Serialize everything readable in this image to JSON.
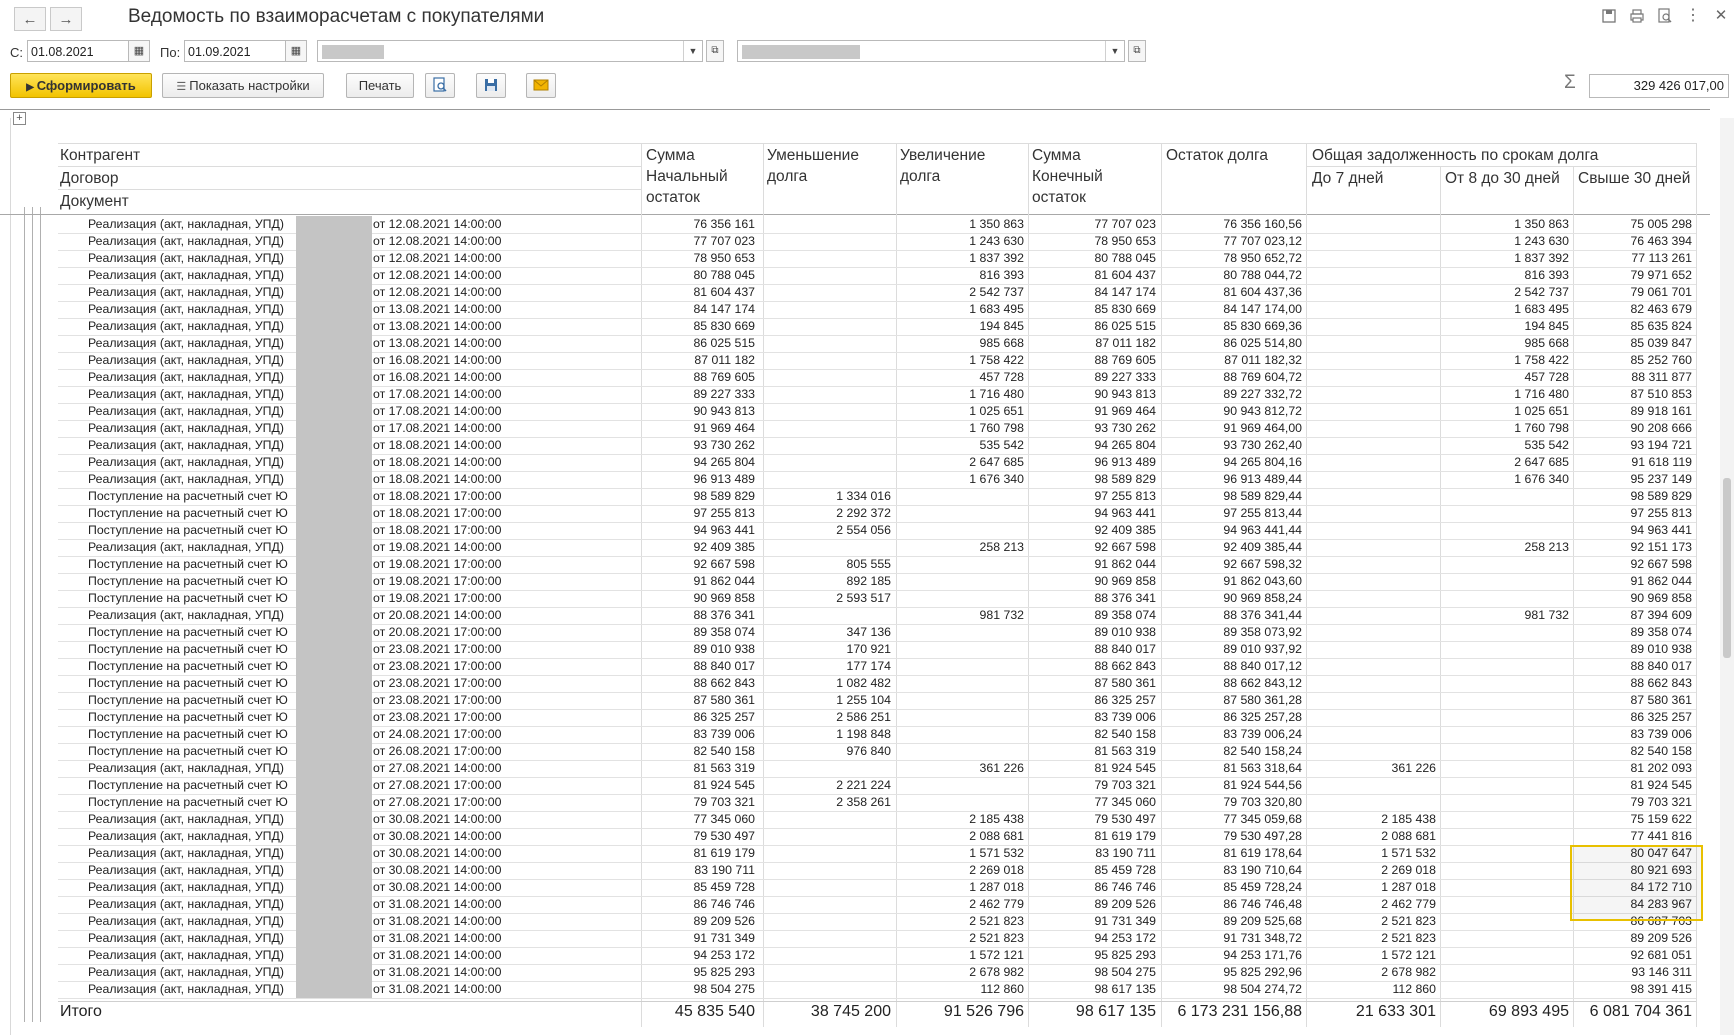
{
  "window": {
    "title": "Ведомость по взаиморасчетам с покупателями",
    "back_icon": "←",
    "forward_icon": "→"
  },
  "filters": {
    "from_label": "С:",
    "from_value": "01.08.2021",
    "to_label": "По:",
    "to_value": "01.09.2021"
  },
  "toolbar": {
    "generate_label": "Сформировать",
    "settings_label": "Показать настройки",
    "print_label": "Печать",
    "sum_value": "329 426 017,00"
  },
  "headers": {
    "c1a": "Контрагент",
    "c1b": "Договор",
    "c1c": "Документ",
    "c2": "Сумма Начальный остаток",
    "c3": "Уменьшение долга",
    "c4": "Увеличение долга",
    "c5": "Сумма Конечный остаток",
    "c6": "Остаток долга",
    "group": "Общая задолженность по срокам долга",
    "c7": "До 7 дней",
    "c8": "От 8 до 30 дней",
    "c9": "Свыше 30 дней"
  },
  "rows": [
    {
      "doc": "Реализация (акт, накладная, УПД)",
      "date": "от 12.08.2021 14:00:00",
      "start": "76 356 161",
      "dec": "",
      "inc": "1 350 863",
      "end": "77 707 023",
      "rest": "76 356 160,56",
      "d7": "",
      "d30": "1 350 863",
      "over": "75 005 298"
    },
    {
      "doc": "Реализация (акт, накладная, УПД)",
      "date": "от 12.08.2021 14:00:00",
      "start": "77 707 023",
      "dec": "",
      "inc": "1 243 630",
      "end": "78 950 653",
      "rest": "77 707 023,12",
      "d7": "",
      "d30": "1 243 630",
      "over": "76 463 394"
    },
    {
      "doc": "Реализация (акт, накладная, УПД)",
      "date": "от 12.08.2021 14:00:00",
      "start": "78 950 653",
      "dec": "",
      "inc": "1 837 392",
      "end": "80 788 045",
      "rest": "78 950 652,72",
      "d7": "",
      "d30": "1 837 392",
      "over": "77 113 261"
    },
    {
      "doc": "Реализация (акт, накладная, УПД)",
      "date": "от 12.08.2021 14:00:00",
      "start": "80 788 045",
      "dec": "",
      "inc": "816 393",
      "end": "81 604 437",
      "rest": "80 788 044,72",
      "d7": "",
      "d30": "816 393",
      "over": "79 971 652"
    },
    {
      "doc": "Реализация (акт, накладная, УПД)",
      "date": "от 12.08.2021 14:00:00",
      "start": "81 604 437",
      "dec": "",
      "inc": "2 542 737",
      "end": "84 147 174",
      "rest": "81 604 437,36",
      "d7": "",
      "d30": "2 542 737",
      "over": "79 061 701"
    },
    {
      "doc": "Реализация (акт, накладная, УПД)",
      "date": "от 13.08.2021 14:00:00",
      "start": "84 147 174",
      "dec": "",
      "inc": "1 683 495",
      "end": "85 830 669",
      "rest": "84 147 174,00",
      "d7": "",
      "d30": "1 683 495",
      "over": "82 463 679"
    },
    {
      "doc": "Реализация (акт, накладная, УПД)",
      "date": "от 13.08.2021 14:00:00",
      "start": "85 830 669",
      "dec": "",
      "inc": "194 845",
      "end": "86 025 515",
      "rest": "85 830 669,36",
      "d7": "",
      "d30": "194 845",
      "over": "85 635 824"
    },
    {
      "doc": "Реализация (акт, накладная, УПД)",
      "date": "от 13.08.2021 14:00:00",
      "start": "86 025 515",
      "dec": "",
      "inc": "985 668",
      "end": "87 011 182",
      "rest": "86 025 514,80",
      "d7": "",
      "d30": "985 668",
      "over": "85 039 847"
    },
    {
      "doc": "Реализация (акт, накладная, УПД)",
      "date": "от 16.08.2021 14:00:00",
      "start": "87 011 182",
      "dec": "",
      "inc": "1 758 422",
      "end": "88 769 605",
      "rest": "87 011 182,32",
      "d7": "",
      "d30": "1 758 422",
      "over": "85 252 760"
    },
    {
      "doc": "Реализация (акт, накладная, УПД)",
      "date": "от 16.08.2021 14:00:00",
      "start": "88 769 605",
      "dec": "",
      "inc": "457 728",
      "end": "89 227 333",
      "rest": "88 769 604,72",
      "d7": "",
      "d30": "457 728",
      "over": "88 311 877"
    },
    {
      "doc": "Реализация (акт, накладная, УПД)",
      "date": "от 17.08.2021 14:00:00",
      "start": "89 227 333",
      "dec": "",
      "inc": "1 716 480",
      "end": "90 943 813",
      "rest": "89 227 332,72",
      "d7": "",
      "d30": "1 716 480",
      "over": "87 510 853"
    },
    {
      "doc": "Реализация (акт, накладная, УПД)",
      "date": "от 17.08.2021 14:00:00",
      "start": "90 943 813",
      "dec": "",
      "inc": "1 025 651",
      "end": "91 969 464",
      "rest": "90 943 812,72",
      "d7": "",
      "d30": "1 025 651",
      "over": "89 918 161"
    },
    {
      "doc": "Реализация (акт, накладная, УПД)",
      "date": "от 17.08.2021 14:00:00",
      "start": "91 969 464",
      "dec": "",
      "inc": "1 760 798",
      "end": "93 730 262",
      "rest": "91 969 464,00",
      "d7": "",
      "d30": "1 760 798",
      "over": "90 208 666"
    },
    {
      "doc": "Реализация (акт, накладная, УПД)",
      "date": "от 18.08.2021 14:00:00",
      "start": "93 730 262",
      "dec": "",
      "inc": "535 542",
      "end": "94 265 804",
      "rest": "93 730 262,40",
      "d7": "",
      "d30": "535 542",
      "over": "93 194 721"
    },
    {
      "doc": "Реализация (акт, накладная, УПД)",
      "date": "от 18.08.2021 14:00:00",
      "start": "94 265 804",
      "dec": "",
      "inc": "2 647 685",
      "end": "96 913 489",
      "rest": "94 265 804,16",
      "d7": "",
      "d30": "2 647 685",
      "over": "91 618 119"
    },
    {
      "doc": "Реализация (акт, накладная, УПД)",
      "date": "от 18.08.2021 14:00:00",
      "start": "96 913 489",
      "dec": "",
      "inc": "1 676 340",
      "end": "98 589 829",
      "rest": "96 913 489,44",
      "d7": "",
      "d30": "1 676 340",
      "over": "95 237 149"
    },
    {
      "doc": "Поступление на расчетный счет Ю",
      "date": "от 18.08.2021 17:00:00",
      "start": "98 589 829",
      "dec": "1 334 016",
      "inc": "",
      "end": "97 255 813",
      "rest": "98 589 829,44",
      "d7": "",
      "d30": "",
      "over": "98 589 829"
    },
    {
      "doc": "Поступление на расчетный счет Ю",
      "date": "от 18.08.2021 17:00:00",
      "start": "97 255 813",
      "dec": "2 292 372",
      "inc": "",
      "end": "94 963 441",
      "rest": "97 255 813,44",
      "d7": "",
      "d30": "",
      "over": "97 255 813"
    },
    {
      "doc": "Поступление на расчетный счет Ю",
      "date": "от 18.08.2021 17:00:00",
      "start": "94 963 441",
      "dec": "2 554 056",
      "inc": "",
      "end": "92 409 385",
      "rest": "94 963 441,44",
      "d7": "",
      "d30": "",
      "over": "94 963 441"
    },
    {
      "doc": "Реализация (акт, накладная, УПД)",
      "date": "от 19.08.2021 14:00:00",
      "start": "92 409 385",
      "dec": "",
      "inc": "258 213",
      "end": "92 667 598",
      "rest": "92 409 385,44",
      "d7": "",
      "d30": "258 213",
      "over": "92 151 173"
    },
    {
      "doc": "Поступление на расчетный счет Ю",
      "date": "от 19.08.2021 17:00:00",
      "start": "92 667 598",
      "dec": "805 555",
      "inc": "",
      "end": "91 862 044",
      "rest": "92 667 598,32",
      "d7": "",
      "d30": "",
      "over": "92 667 598"
    },
    {
      "doc": "Поступление на расчетный счет Ю",
      "date": "от 19.08.2021 17:00:00",
      "start": "91 862 044",
      "dec": "892 185",
      "inc": "",
      "end": "90 969 858",
      "rest": "91 862 043,60",
      "d7": "",
      "d30": "",
      "over": "91 862 044"
    },
    {
      "doc": "Поступление на расчетный счет Ю",
      "date": "от 19.08.2021 17:00:00",
      "start": "90 969 858",
      "dec": "2 593 517",
      "inc": "",
      "end": "88 376 341",
      "rest": "90 969 858,24",
      "d7": "",
      "d30": "",
      "over": "90 969 858"
    },
    {
      "doc": "Реализация (акт, накладная, УПД)",
      "date": "от 20.08.2021 14:00:00",
      "start": "88 376 341",
      "dec": "",
      "inc": "981 732",
      "end": "89 358 074",
      "rest": "88 376 341,44",
      "d7": "",
      "d30": "981 732",
      "over": "87 394 609"
    },
    {
      "doc": "Поступление на расчетный счет Ю",
      "date": "от 20.08.2021 17:00:00",
      "start": "89 358 074",
      "dec": "347 136",
      "inc": "",
      "end": "89 010 938",
      "rest": "89 358 073,92",
      "d7": "",
      "d30": "",
      "over": "89 358 074"
    },
    {
      "doc": "Поступление на расчетный счет Ю",
      "date": "от 23.08.2021 17:00:00",
      "start": "89 010 938",
      "dec": "170 921",
      "inc": "",
      "end": "88 840 017",
      "rest": "89 010 937,92",
      "d7": "",
      "d30": "",
      "over": "89 010 938"
    },
    {
      "doc": "Поступление на расчетный счет Ю",
      "date": "от 23.08.2021 17:00:00",
      "start": "88 840 017",
      "dec": "177 174",
      "inc": "",
      "end": "88 662 843",
      "rest": "88 840 017,12",
      "d7": "",
      "d30": "",
      "over": "88 840 017"
    },
    {
      "doc": "Поступление на расчетный счет Ю",
      "date": "от 23.08.2021 17:00:00",
      "start": "88 662 843",
      "dec": "1 082 482",
      "inc": "",
      "end": "87 580 361",
      "rest": "88 662 843,12",
      "d7": "",
      "d30": "",
      "over": "88 662 843"
    },
    {
      "doc": "Поступление на расчетный счет Ю",
      "date": "от 23.08.2021 17:00:00",
      "start": "87 580 361",
      "dec": "1 255 104",
      "inc": "",
      "end": "86 325 257",
      "rest": "87 580 361,28",
      "d7": "",
      "d30": "",
      "over": "87 580 361"
    },
    {
      "doc": "Поступление на расчетный счет Ю",
      "date": "от 23.08.2021 17:00:00",
      "start": "86 325 257",
      "dec": "2 586 251",
      "inc": "",
      "end": "83 739 006",
      "rest": "86 325 257,28",
      "d7": "",
      "d30": "",
      "over": "86 325 257"
    },
    {
      "doc": "Поступление на расчетный счет Ю",
      "date": "от 24.08.2021 17:00:00",
      "start": "83 739 006",
      "dec": "1 198 848",
      "inc": "",
      "end": "82 540 158",
      "rest": "83 739 006,24",
      "d7": "",
      "d30": "",
      "over": "83 739 006"
    },
    {
      "doc": "Поступление на расчетный счет Ю",
      "date": "от 26.08.2021 17:00:00",
      "start": "82 540 158",
      "dec": "976 840",
      "inc": "",
      "end": "81 563 319",
      "rest": "82 540 158,24",
      "d7": "",
      "d30": "",
      "over": "82 540 158"
    },
    {
      "doc": "Реализация (акт, накладная, УПД)",
      "date": "от 27.08.2021 14:00:00",
      "start": "81 563 319",
      "dec": "",
      "inc": "361 226",
      "end": "81 924 545",
      "rest": "81 563 318,64",
      "d7": "361 226",
      "d30": "",
      "over": "81 202 093"
    },
    {
      "doc": "Поступление на расчетный счет Ю",
      "date": "от 27.08.2021 17:00:00",
      "start": "81 924 545",
      "dec": "2 221 224",
      "inc": "",
      "end": "79 703 321",
      "rest": "81 924 544,56",
      "d7": "",
      "d30": "",
      "over": "81 924 545"
    },
    {
      "doc": "Поступление на расчетный счет Ю",
      "date": "от 27.08.2021 17:00:00",
      "start": "79 703 321",
      "dec": "2 358 261",
      "inc": "",
      "end": "77 345 060",
      "rest": "79 703 320,80",
      "d7": "",
      "d30": "",
      "over": "79 703 321"
    },
    {
      "doc": "Реализация (акт, накладная, УПД)",
      "date": "от 30.08.2021 14:00:00",
      "start": "77 345 060",
      "dec": "",
      "inc": "2 185 438",
      "end": "79 530 497",
      "rest": "77 345 059,68",
      "d7": "2 185 438",
      "d30": "",
      "over": "75 159 622"
    },
    {
      "doc": "Реализация (акт, накладная, УПД)",
      "date": "от 30.08.2021 14:00:00",
      "start": "79 530 497",
      "dec": "",
      "inc": "2 088 681",
      "end": "81 619 179",
      "rest": "79 530 497,28",
      "d7": "2 088 681",
      "d30": "",
      "over": "77 441 816"
    },
    {
      "doc": "Реализация (акт, накладная, УПД)",
      "date": "от 30.08.2021 14:00:00",
      "start": "81 619 179",
      "dec": "",
      "inc": "1 571 532",
      "end": "83 190 711",
      "rest": "81 619 178,64",
      "d7": "1 571 532",
      "d30": "",
      "over": "80 047 647"
    },
    {
      "doc": "Реализация (акт, накладная, УПД)",
      "date": "от 30.08.2021 14:00:00",
      "start": "83 190 711",
      "dec": "",
      "inc": "2 269 018",
      "end": "85 459 728",
      "rest": "83 190 710,64",
      "d7": "2 269 018",
      "d30": "",
      "over": "80 921 693"
    },
    {
      "doc": "Реализация (акт, накладная, УПД)",
      "date": "от 30.08.2021 14:00:00",
      "start": "85 459 728",
      "dec": "",
      "inc": "1 287 018",
      "end": "86 746 746",
      "rest": "85 459 728,24",
      "d7": "1 287 018",
      "d30": "",
      "over": "84 172 710"
    },
    {
      "doc": "Реализация (акт, накладная, УПД)",
      "date": "от 31.08.2021 14:00:00",
      "start": "86 746 746",
      "dec": "",
      "inc": "2 462 779",
      "end": "89 209 526",
      "rest": "86 746 746,48",
      "d7": "2 462 779",
      "d30": "",
      "over": "84 283 967"
    },
    {
      "doc": "Реализация (акт, накладная, УПД)",
      "date": "от 31.08.2021 14:00:00",
      "start": "89 209 526",
      "dec": "",
      "inc": "2 521 823",
      "end": "91 731 349",
      "rest": "89 209 525,68",
      "d7": "2 521 823",
      "d30": "",
      "over": "86 687 703"
    },
    {
      "doc": "Реализация (акт, накладная, УПД)",
      "date": "от 31.08.2021 14:00:00",
      "start": "91 731 349",
      "dec": "",
      "inc": "2 521 823",
      "end": "94 253 172",
      "rest": "91 731 348,72",
      "d7": "2 521 823",
      "d30": "",
      "over": "89 209 526"
    },
    {
      "doc": "Реализация (акт, накладная, УПД)",
      "date": "от 31.08.2021 14:00:00",
      "start": "94 253 172",
      "dec": "",
      "inc": "1 572 121",
      "end": "95 825 293",
      "rest": "94 253 171,76",
      "d7": "1 572 121",
      "d30": "",
      "over": "92 681 051"
    },
    {
      "doc": "Реализация (акт, накладная, УПД)",
      "date": "от 31.08.2021 14:00:00",
      "start": "95 825 293",
      "dec": "",
      "inc": "2 678 982",
      "end": "98 504 275",
      "rest": "95 825 292,96",
      "d7": "2 678 982",
      "d30": "",
      "over": "93 146 311"
    },
    {
      "doc": "Реализация (акт, накладная, УПД)",
      "date": "от 31.08.2021 14:00:00",
      "start": "98 504 275",
      "dec": "",
      "inc": "112 860",
      "end": "98 617 135",
      "rest": "98 504 274,72",
      "d7": "112 860",
      "d30": "",
      "over": "98 391 415"
    }
  ],
  "totals": {
    "label": "Итого",
    "start": "45 835 540",
    "dec": "38 745 200",
    "inc": "91 526 796",
    "end": "98 617 135",
    "rest": "6 173 231 156,88",
    "d7": "21 633 301",
    "d30": "69 893 495",
    "over": "6 081 704 361"
  },
  "colors": {
    "accent_yellow": "#f2c300",
    "selection_border": "#e8c000"
  }
}
